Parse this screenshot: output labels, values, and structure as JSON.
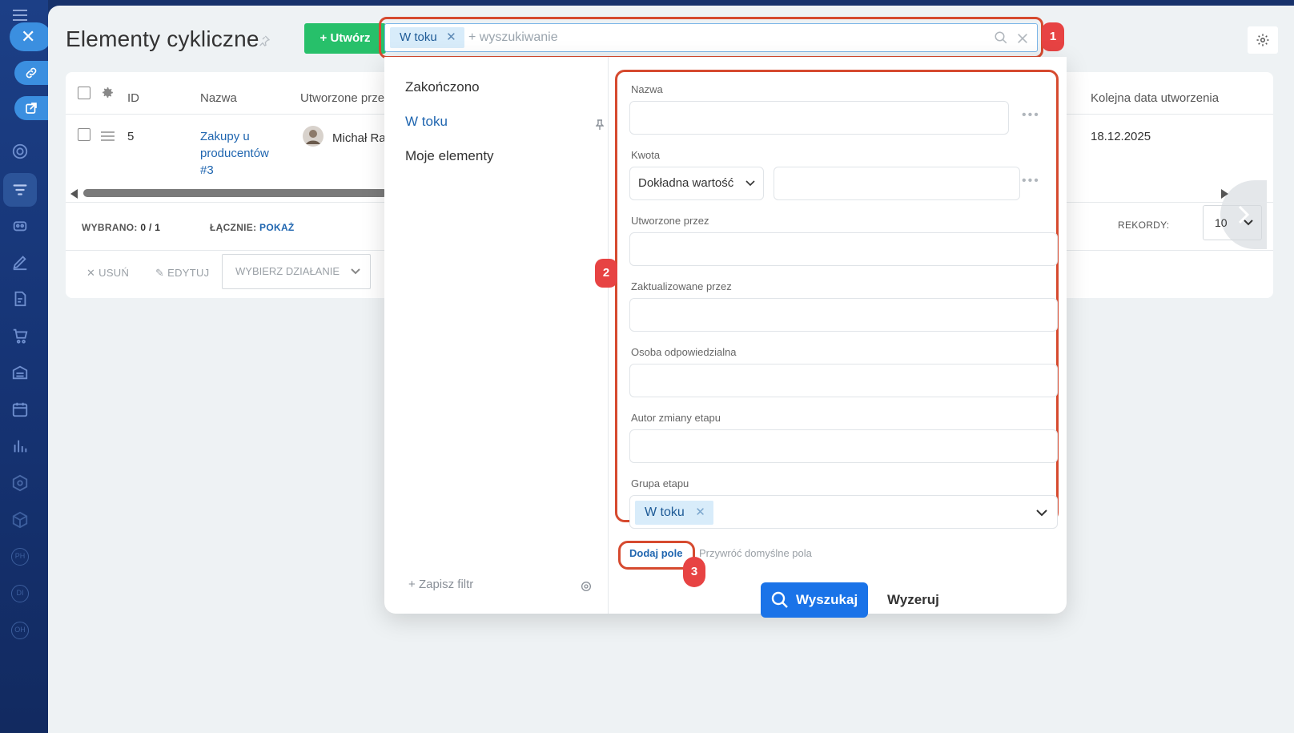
{
  "page": {
    "title": "Elementy cykliczne",
    "create_label": "Utwórz"
  },
  "search": {
    "chip_label": "W toku",
    "placeholder": "+ wyszukiwanie"
  },
  "grid": {
    "headers": [
      "ID",
      "Nazwa",
      "Utworzone prze",
      "Kolejna data utworzenia"
    ],
    "row": {
      "id": "5",
      "name": "Zakupy u producentów #3",
      "created_by": "Michał Ra",
      "next_date": "18.12.2025"
    },
    "selected_label": "WYBRANO:",
    "selected_value": "0 / 1",
    "total_label": "ŁĄCZNIE:",
    "total_link": "POKAŻ",
    "records_label": "REKORDY:",
    "records_value": "10",
    "delete_label": "USUŃ",
    "edit_label": "EDYTUJ",
    "action_label": "WYBIERZ DZIAŁANIE"
  },
  "filter": {
    "presets": [
      "Zakończono",
      "W toku",
      "Moje elementy"
    ],
    "active_preset": "W toku",
    "save_filter_label": "Zapisz filtr",
    "fields": {
      "name_label": "Nazwa",
      "amount_label": "Kwota",
      "amount_mode": "Dokładna wartość",
      "created_by_label": "Utworzone przez",
      "updated_by_label": "Zaktualizowane przez",
      "responsible_label": "Osoba odpowiedzialna",
      "stage_author_label": "Autor zmiany etapu",
      "stage_group_label": "Grupa etapu",
      "stage_group_value": "W toku"
    },
    "add_field_label": "Dodaj pole",
    "restore_label": "Przywróć domyślne pola",
    "search_label": "Wyszukaj",
    "reset_label": "Wyzeruj"
  },
  "annotations": {
    "badge1": "1",
    "badge2": "2",
    "badge3": "3",
    "color": "#d64a2f"
  },
  "colors": {
    "accent": "#1a73e8",
    "create": "#27c06a",
    "rail": "#17326b"
  }
}
